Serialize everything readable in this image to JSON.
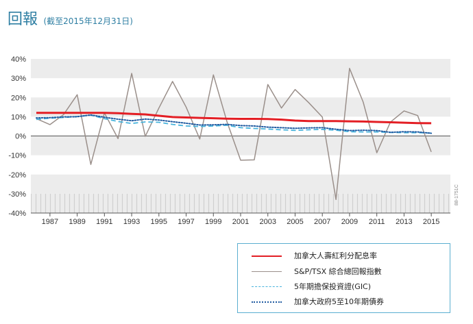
{
  "header": {
    "title": "回報",
    "subtitle": "(截至2015年12月31日)"
  },
  "colors": {
    "title": "#2f7fa3",
    "band": "#ececec",
    "hatch": "#cfcfcf",
    "axis": "#555555",
    "legend_border": "#5aaed0"
  },
  "chart_data": {
    "type": "line",
    "ylim": [
      -40,
      40
    ],
    "y_ticks": [
      40,
      30,
      20,
      10,
      0,
      -10,
      -20,
      -30,
      -40
    ],
    "y_tick_labels": [
      "40%",
      "30%",
      "20%",
      "10%",
      "0%",
      "-10%",
      "-20%",
      "-30%",
      "-40%"
    ],
    "x_range": [
      1986,
      2016
    ],
    "x_ticks": [
      1987,
      1989,
      1991,
      1993,
      1995,
      1997,
      1999,
      2001,
      2003,
      2005,
      2007,
      2009,
      2011,
      2013,
      2015
    ],
    "x_tick_labels": [
      "1987",
      "1989",
      "1991",
      "1993",
      "1995",
      "1997",
      "1999",
      "2001",
      "2003",
      "2005",
      "2007",
      "2009",
      "2011",
      "2013",
      "2015"
    ],
    "x": [
      1986,
      1987,
      1988,
      1989,
      1990,
      1991,
      1992,
      1993,
      1994,
      1995,
      1996,
      1997,
      1998,
      1999,
      2000,
      2001,
      2002,
      2003,
      2004,
      2005,
      2006,
      2007,
      2008,
      2009,
      2010,
      2011,
      2012,
      2013,
      2014,
      2015
    ],
    "series": [
      {
        "name": "加拿大人壽紅利分配息率",
        "color": "#e31e24",
        "style": "solid",
        "values": [
          12.0,
          12.0,
          12.0,
          12.0,
          12.0,
          12.0,
          11.8,
          11.5,
          11.2,
          10.5,
          9.8,
          9.6,
          9.4,
          9.2,
          9.0,
          8.9,
          8.9,
          8.8,
          8.5,
          8.0,
          7.7,
          7.7,
          7.7,
          7.6,
          7.5,
          7.3,
          7.1,
          6.9,
          6.7,
          6.6
        ]
      },
      {
        "name": "S&P/TSX 綜合總回報指數",
        "color": "#9a8f8a",
        "style": "solid",
        "values": [
          9.0,
          5.9,
          11.1,
          21.4,
          -14.8,
          12.0,
          -1.4,
          32.5,
          -0.2,
          14.5,
          28.3,
          15.0,
          -1.6,
          31.7,
          7.4,
          -12.6,
          -12.4,
          26.7,
          14.5,
          24.1,
          17.3,
          9.8,
          -33.0,
          35.1,
          17.6,
          -8.7,
          7.2,
          13.0,
          10.6,
          -8.3
        ]
      },
      {
        "name": "5年期擔保投資證(GIC)",
        "color": "#47b3dc",
        "style": "dashed",
        "values": [
          8.6,
          9.2,
          9.6,
          10.1,
          10.8,
          9.0,
          7.5,
          6.5,
          7.3,
          7.1,
          6.0,
          5.2,
          4.9,
          5.2,
          5.6,
          4.3,
          3.9,
          3.6,
          3.2,
          2.9,
          3.2,
          3.4,
          3.0,
          2.2,
          2.1,
          2.1,
          1.8,
          1.7,
          1.7,
          1.5
        ]
      },
      {
        "name": "加拿大政府5至10年期債券",
        "color": "#1f5aa0",
        "style": "dotted",
        "values": [
          9.4,
          9.5,
          9.9,
          10.0,
          10.9,
          9.7,
          8.7,
          7.9,
          8.8,
          8.3,
          7.4,
          6.6,
          5.7,
          5.8,
          6.0,
          5.4,
          5.2,
          4.6,
          4.3,
          4.0,
          4.2,
          4.3,
          3.5,
          2.8,
          3.0,
          2.8,
          1.9,
          2.2,
          2.1,
          1.4
        ]
      }
    ]
  },
  "legend": {
    "items": [
      {
        "label": "加拿大人壽紅利分配息率",
        "color": "#e31e24",
        "style": "solid"
      },
      {
        "label": "S&P/TSX 綜合總回報指數",
        "color": "#9a8f8a",
        "style": "solid"
      },
      {
        "label": "5年期擔保投資證(GIC)",
        "color": "#47b3dc",
        "style": "dashed"
      },
      {
        "label": "加拿大政府5至10年期債券",
        "color": "#1f5aa0",
        "style": "dotted"
      }
    ]
  },
  "footnote": "88-1751C"
}
